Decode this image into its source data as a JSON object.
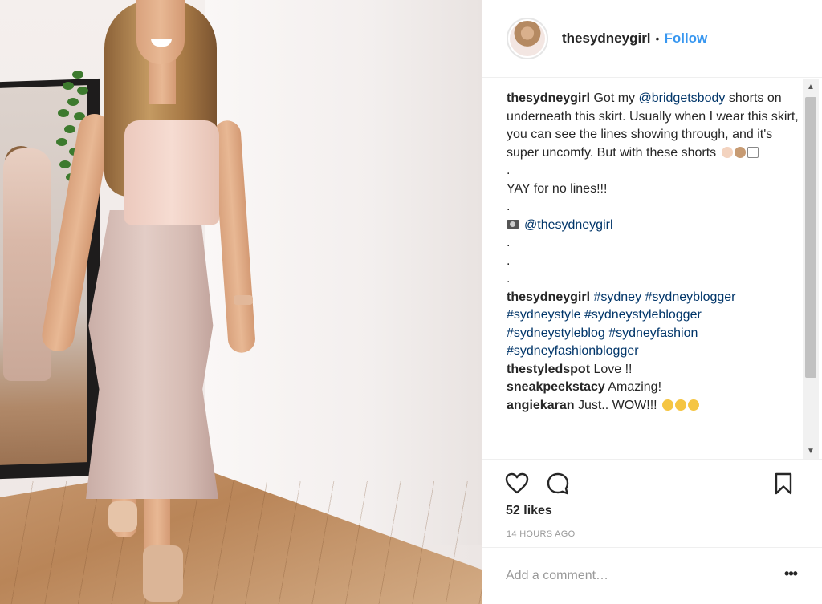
{
  "header": {
    "username": "thesydneygirl",
    "separator": "•",
    "follow_label": "Follow"
  },
  "caption": {
    "username": "thesydneygirl",
    "text_before": "Got my",
    "mention": "@bridgetsbody",
    "text_after": "shorts on underneath this skirt. Usually when I wear this skirt, you can see the lines showing through, and it's super uncomfy. But with these shorts",
    "dot": ".",
    "line2": "YAY for no lines!!!",
    "photo_credit": "@thesydneygirl"
  },
  "hashtag_comment": {
    "username": "thesydneygirl",
    "tags": "#sydney #sydneyblogger #sydneystyle #sydneystyleblogger #sydneystyleblog #sydneyfashion #sydneyfashionblogger"
  },
  "comments": [
    {
      "username": "thestyledspot",
      "text": "Love !!"
    },
    {
      "username": "sneakpeekstacy",
      "text": "Amazing!"
    },
    {
      "username": "angiekaran",
      "text": "Just.. WOW!!!"
    }
  ],
  "likes": "52 likes",
  "timestamp": "14 HOURS AGO",
  "comment_input": {
    "placeholder": "Add a comment…"
  },
  "more_label": "•••",
  "scroll": {
    "up": "▲",
    "down": "▼"
  },
  "icons": {
    "like": "heart-icon",
    "comment": "speech-bubble-icon",
    "save": "bookmark-icon",
    "photo_credit": "camera-icon"
  },
  "colors": {
    "link": "#003569",
    "follow": "#3897f0",
    "meta": "#999999"
  }
}
